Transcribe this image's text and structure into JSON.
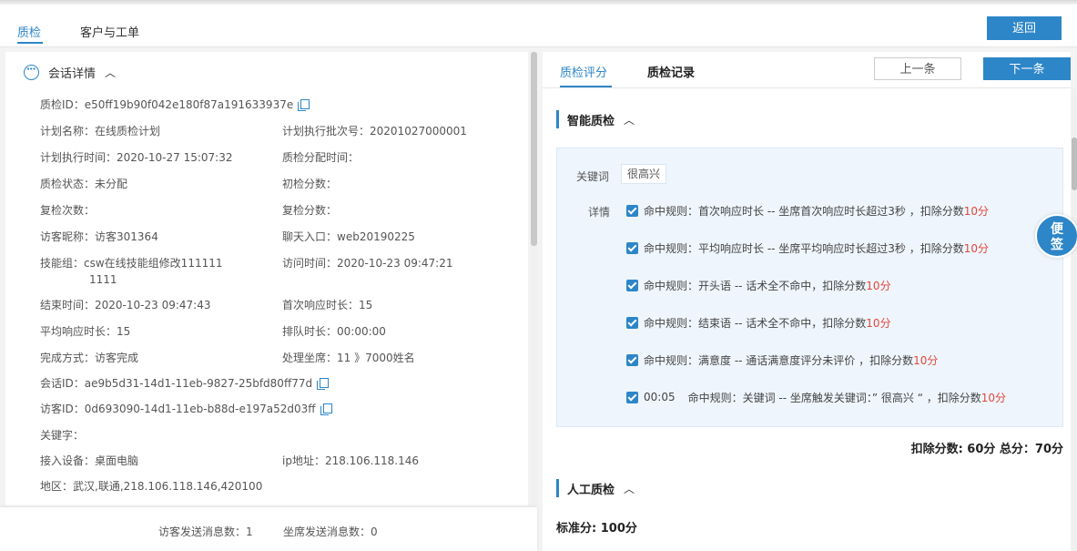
{
  "top_tabs": [
    {
      "label": "质检",
      "active": true
    },
    {
      "label": "客户与工单",
      "active": false
    }
  ],
  "back_button": "返回",
  "session": {
    "title": "会话详情",
    "qc_id": {
      "label": "质检ID：",
      "value": "e50ff19b90f042e180f87a191633937e"
    },
    "plan_name": {
      "label": "计划名称：",
      "value": "在线质检计划"
    },
    "plan_batch": {
      "label": "计划执行批次号：",
      "value": "20201027000001"
    },
    "plan_time": {
      "label": "计划执行时间：",
      "value": "2020-10-27 15:07:32"
    },
    "assign_time": {
      "label": "质检分配时间：",
      "value": ""
    },
    "qc_status": {
      "label": "质检状态：",
      "value": "未分配"
    },
    "init_score": {
      "label": "初检分数：",
      "value": ""
    },
    "recheck_count": {
      "label": "复检次数：",
      "value": ""
    },
    "recheck_score": {
      "label": "复检分数：",
      "value": ""
    },
    "visitor_nick": {
      "label": "访客昵称：",
      "value": "访客301364"
    },
    "chat_entry": {
      "label": "聊天入口：",
      "value": "web20190225"
    },
    "skill_group": {
      "label": "技能组：",
      "value_line1": "csw在线技能组修改111111",
      "value_line2": "1111"
    },
    "visit_time": {
      "label": "访问时间：",
      "value": "2020-10-23 09:47:21"
    },
    "end_time": {
      "label": "结束时间：",
      "value": "2020-10-23 09:47:43"
    },
    "first_response": {
      "label": "首次响应时长：",
      "value": "15"
    },
    "avg_response": {
      "label": "平均响应时长：",
      "value": "15"
    },
    "queue_time": {
      "label": "排队时长：",
      "value": "00:00:00"
    },
    "finish_way": {
      "label": "完成方式：",
      "value": "访客完成"
    },
    "handler": {
      "label": "处理坐席：",
      "value": "11 》7000姓名"
    },
    "session_id": {
      "label": "会话ID：",
      "value": "ae9b5d31-14d1-11eb-9827-25bfd80ff77d"
    },
    "visitor_id": {
      "label": "访客ID：",
      "value": "0d693090-14d1-11eb-b88d-e197a52d03ff"
    },
    "keywords": {
      "label": "关键字：",
      "value": ""
    },
    "device": {
      "label": "接入设备：",
      "value": "桌面电脑"
    },
    "ip": {
      "label": "ip地址：",
      "value": "218.106.118.146"
    },
    "region": {
      "label": "地区：",
      "value": "武汉,联通,218.106.118.146,420100"
    }
  },
  "footer": {
    "visitor_msgs": "访客发送消息数：1",
    "agent_msgs": "坐席发送消息数：0"
  },
  "right_tabs": [
    {
      "label": "质检评分",
      "active": true
    },
    {
      "label": "质检记录",
      "active": false
    }
  ],
  "prev_button": "上一条",
  "next_button": "下一条",
  "ai_section": {
    "title": "智能质检",
    "keyword_label": "关键词",
    "keyword_tag": "很高兴",
    "detail_label": "详情",
    "rules": [
      {
        "time": "",
        "text": "命中规则：首次响应时长 -- 坐席首次响应时长超过3秒 ，扣除分数 ",
        "score": "10分"
      },
      {
        "time": "",
        "text": "命中规则：平均响应时长 -- 坐席平均响应时长超过3秒 ，扣除分数 ",
        "score": "10分"
      },
      {
        "time": "",
        "text": "命中规则：开头语 -- 话术全不命中，扣除分数 ",
        "score": "10分"
      },
      {
        "time": "",
        "text": "命中规则：结束语 -- 话术全不命中，扣除分数 ",
        "score": "10分"
      },
      {
        "time": "",
        "text": "命中规则：满意度 -- 通话满意度评分未评价 ，扣除分数 ",
        "score": "10分"
      },
      {
        "time": "00:05",
        "text": "命中规则：关键词 -- 坐席触发关键词：” 很高兴 “ ，扣除分数 ",
        "score": "10分"
      }
    ],
    "totals": "扣除分数: 60分 总分：70分"
  },
  "manual_section": {
    "title": "人工质检",
    "standard_score": "标准分: 100分"
  },
  "sticky_note": {
    "line1": "便",
    "line2": "签"
  },
  "colors": {
    "accent": "#2d86c8",
    "deduct": "#e0483a"
  }
}
